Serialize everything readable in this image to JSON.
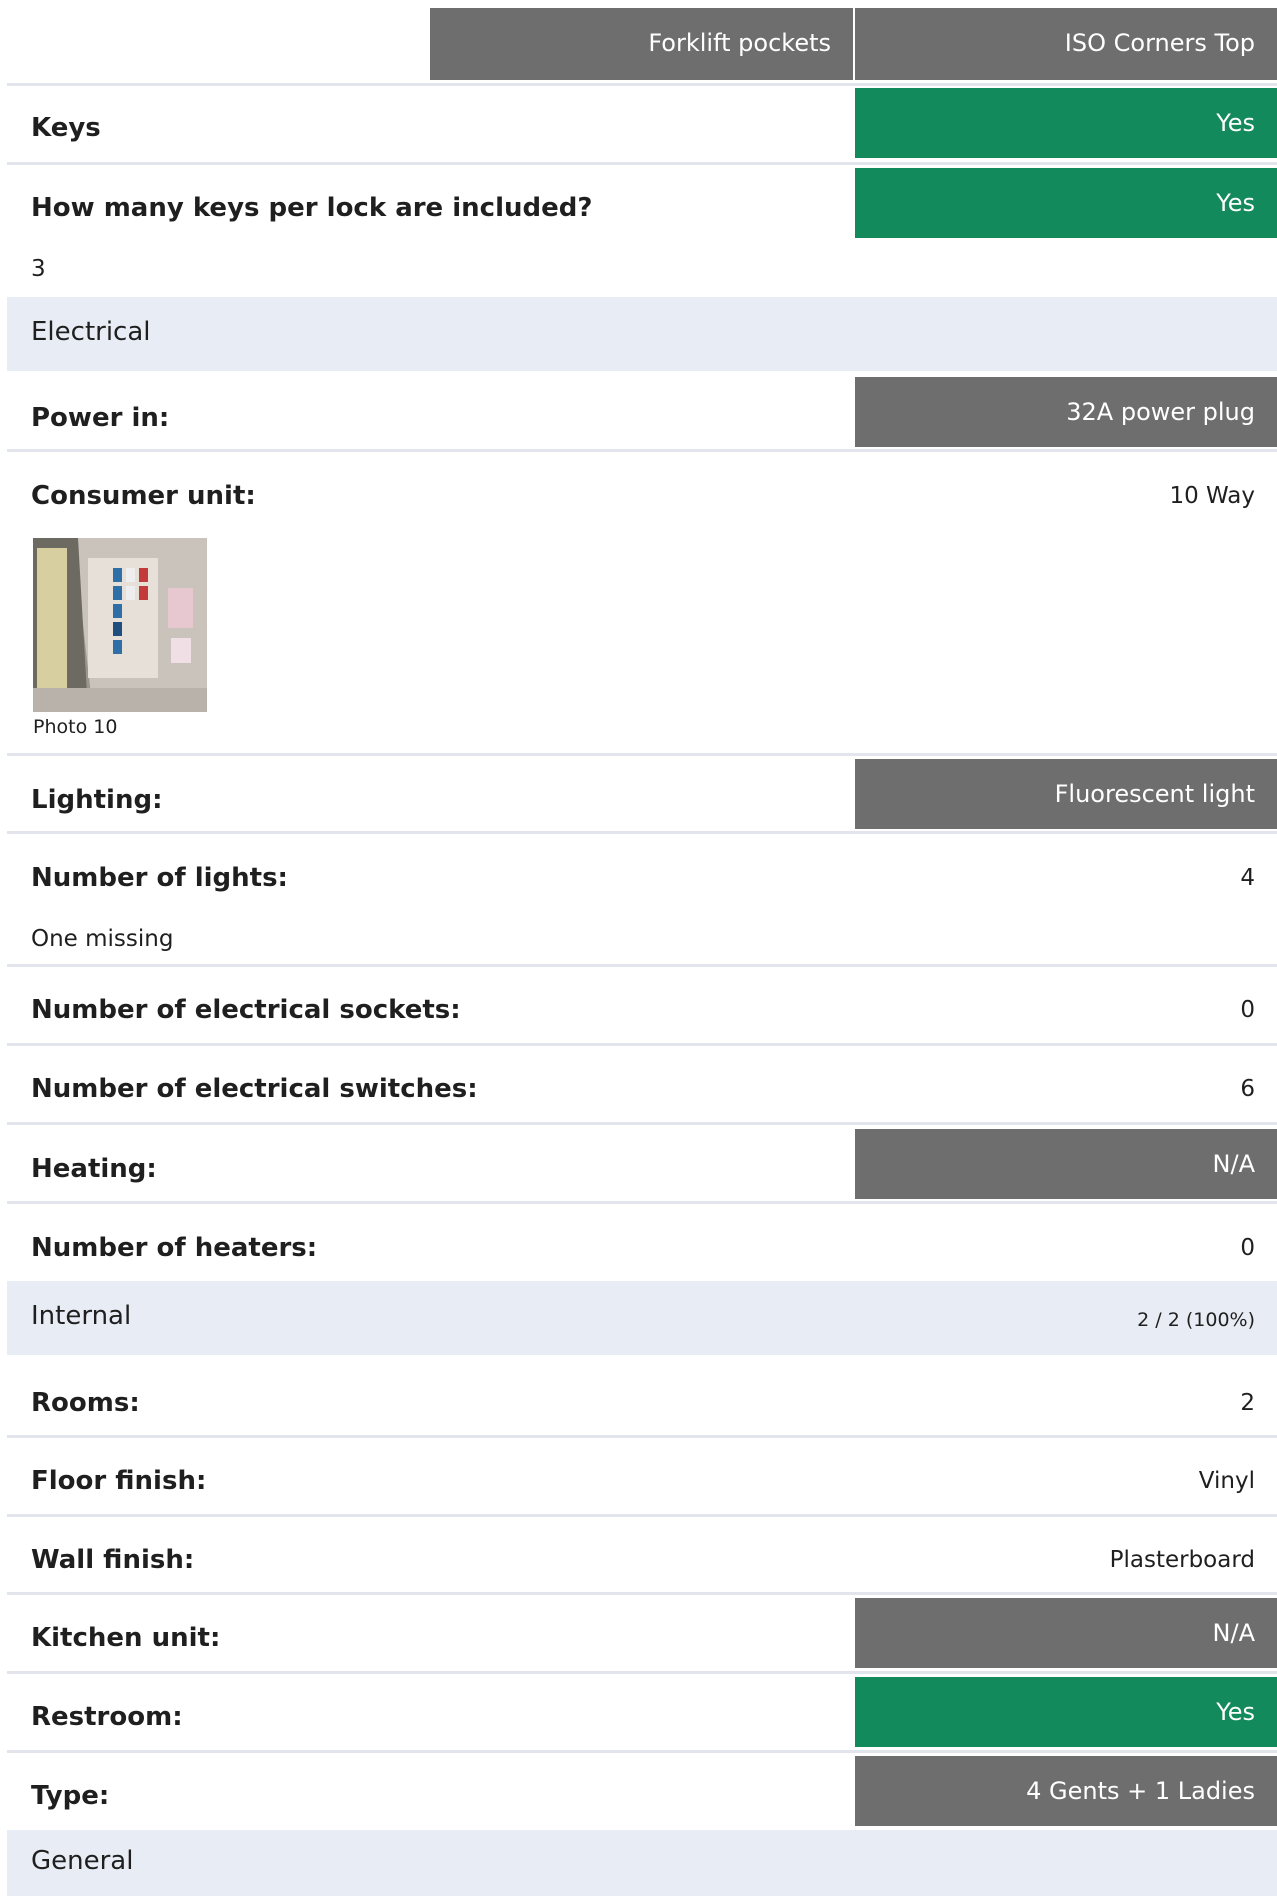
{
  "header": {
    "col1": "Forklift pockets",
    "col2": "ISO Corners Top"
  },
  "rows": {
    "keys": {
      "label": "Keys",
      "value": "Yes"
    },
    "keys_per_lock": {
      "label": "How many keys per lock are included?",
      "value": "Yes",
      "note": "3"
    },
    "electrical_section": {
      "title": "Electrical"
    },
    "power_in": {
      "label": "Power in:",
      "value": "32A power plug"
    },
    "consumer_unit": {
      "label": "Consumer unit:",
      "value": "10 Way",
      "photo_caption": "Photo 10"
    },
    "lighting": {
      "label": "Lighting:",
      "value": "Fluorescent light"
    },
    "number_of_lights": {
      "label": "Number of lights:",
      "value": "4",
      "note": "One missing"
    },
    "sockets": {
      "label": "Number of electrical sockets:",
      "value": "0"
    },
    "switches": {
      "label": "Number of electrical switches:",
      "value": "6"
    },
    "heating": {
      "label": "Heating:",
      "value": "N/A"
    },
    "heaters": {
      "label": "Number of heaters:",
      "value": "0"
    },
    "internal_section": {
      "title": "Internal",
      "progress": "2 / 2 (100%)"
    },
    "rooms": {
      "label": "Rooms:",
      "value": "2"
    },
    "floor_finish": {
      "label": "Floor finish:",
      "value": "Vinyl"
    },
    "wall_finish": {
      "label": "Wall finish:",
      "value": "Plasterboard"
    },
    "kitchen_unit": {
      "label": "Kitchen unit:",
      "value": "N/A"
    },
    "restroom": {
      "label": "Restroom:",
      "value": "Yes"
    },
    "type": {
      "label": "Type:",
      "value": "4 Gents + 1 Ladies"
    },
    "general_section": {
      "title": "General"
    }
  },
  "colors": {
    "header_grey": "#6e6e6e",
    "yes_green": "#138a5c",
    "section_bg": "#e8ecf4"
  }
}
